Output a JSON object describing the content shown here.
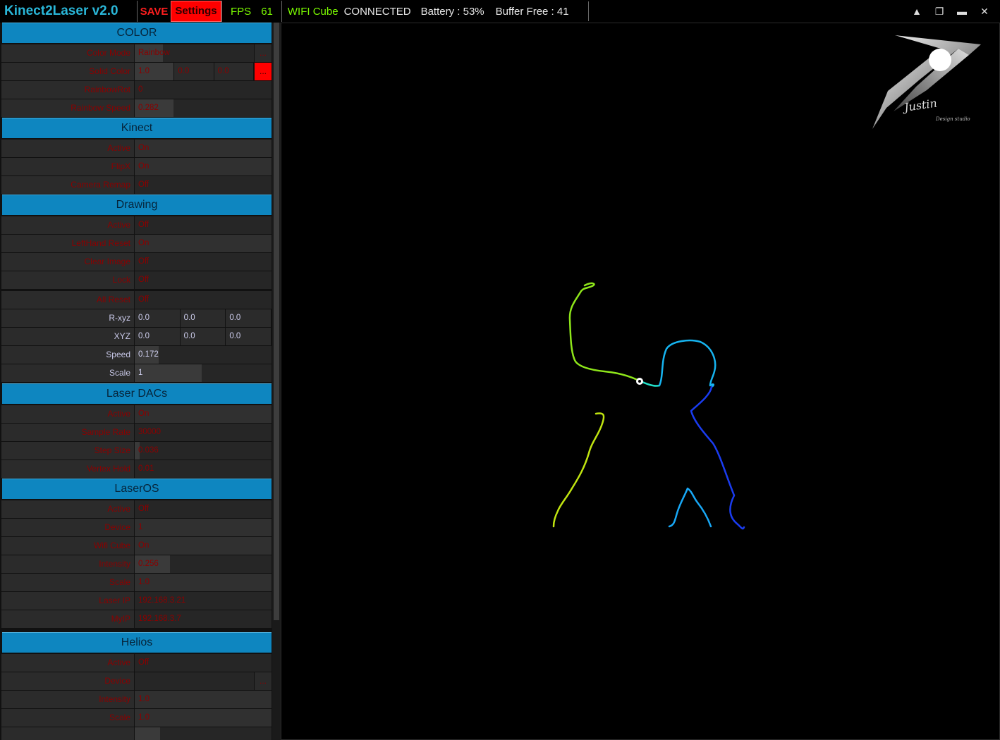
{
  "titlebar": {
    "app_title": "Kinect2Laser v2.0",
    "save_label": "SAVE",
    "settings_label": "Settings",
    "fps_label": "FPS",
    "fps_value": "61",
    "wifi_label": "WIFI Cube",
    "wifi_status": "CONNECTED",
    "battery": "Battery : 53%",
    "buffer": "Buffer Free : 41",
    "window_buttons": [
      "▲",
      "❐",
      "▬",
      "✕"
    ]
  },
  "sections": {
    "color": {
      "title": "COLOR",
      "color_mode": {
        "label": "Color Mode",
        "value": "Rainbow",
        "button": "..."
      },
      "solid_color": {
        "label": "Solid Color",
        "values": [
          "1.0",
          "0.0",
          "0.0"
        ],
        "button": "..."
      },
      "rainbow_rot": {
        "label": "RainbowRot",
        "value": "0"
      },
      "rainbow_speed": {
        "label": "Rainbow Speed",
        "value": "0.282"
      }
    },
    "kinect": {
      "title": "Kinect",
      "active": {
        "label": "Active",
        "value": "On"
      },
      "flipx": {
        "label": "FlipX",
        "value": "On"
      },
      "camera_remap": {
        "label": "Camera Remap",
        "value": "Off"
      }
    },
    "drawing": {
      "title": "Drawing",
      "active": {
        "label": "Active",
        "value": "Off"
      },
      "lefthand_reset": {
        "label": "LeftHand Reset",
        "value": "On"
      },
      "clear_image": {
        "label": "Clear Image",
        "value": "Off"
      },
      "lock": {
        "label": "Lock",
        "value": "Off"
      },
      "all_reset": {
        "label": "All Reset",
        "value": "Off"
      },
      "rxyz": {
        "label": "R-xyz",
        "values": [
          "0.0",
          "0.0",
          "0.0"
        ]
      },
      "xyz": {
        "label": "XYZ",
        "values": [
          "0.0",
          "0.0",
          "0.0"
        ]
      },
      "speed": {
        "label": "Speed",
        "value": "0.172"
      },
      "scale": {
        "label": "Scale",
        "value": "1"
      }
    },
    "laser_dacs": {
      "title": "Laser DACs",
      "active": {
        "label": "Active",
        "value": "On"
      },
      "sample_rate": {
        "label": "Sample Rate",
        "value": "30000"
      },
      "step_size": {
        "label": "Step Size",
        "value": "0.036"
      },
      "vertex_hold": {
        "label": "Vertex Hold",
        "value": "0.01"
      }
    },
    "laseros": {
      "title": "LaserOS",
      "active": {
        "label": "Active",
        "value": "Off"
      },
      "device": {
        "label": "Device",
        "value": "1"
      },
      "wifi_cube": {
        "label": "Wifi Cube",
        "value": "On"
      },
      "intensity": {
        "label": "Intensity",
        "value": "0.256"
      },
      "scale": {
        "label": "Scale",
        "value": "1.0"
      },
      "laser_ip": {
        "label": "Laser IP",
        "value": "192.168.3.21"
      },
      "my_ip": {
        "label": "MyIP",
        "value": "192.168.3.7"
      }
    },
    "helios": {
      "title": "Helios",
      "active": {
        "label": "Active",
        "value": "Off"
      },
      "device": {
        "label": "Device",
        "value": "",
        "button": "..."
      },
      "intensity": {
        "label": "Intensity",
        "value": "1.0"
      },
      "scale": {
        "label": "Scale",
        "value": "1.0"
      }
    }
  },
  "logo": {
    "text": "Justin",
    "subtext": "Design studio"
  },
  "colors": {
    "accent": "#0e86c0",
    "title": "#2ab7d9",
    "save": "#ff1e1e",
    "settings_bg": "#ff0000",
    "status_green": "#7cfc00",
    "dark_value": "#8b0000"
  },
  "slider_levels": {
    "rainbow_speed": 0.282,
    "drawing_speed": 0.172,
    "step_size": 0.036,
    "laseros_intensity": 0.256
  }
}
